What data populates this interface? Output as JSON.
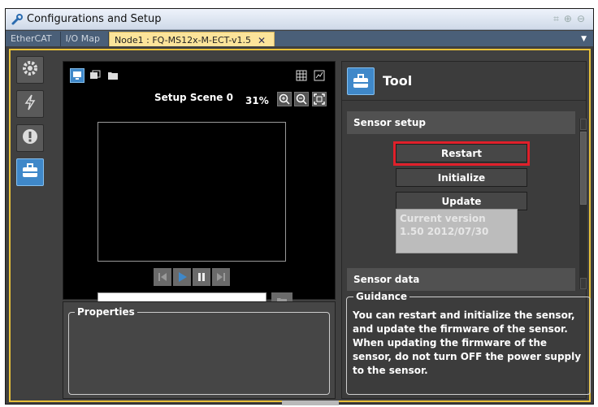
{
  "window": {
    "title": "Configurations and Setup"
  },
  "tabs": [
    {
      "label": "EtherCAT"
    },
    {
      "label": "I/O Map"
    },
    {
      "label": "Node1 : FQ-MS12x-M-ECT-v1.5",
      "active": true
    }
  ],
  "sidebar": {
    "items": [
      {
        "icon": "gear-icon"
      },
      {
        "icon": "lightning-icon"
      },
      {
        "icon": "exclamation-icon"
      },
      {
        "icon": "toolbox-icon",
        "active": true
      }
    ]
  },
  "viewer": {
    "scene_label": "Setup Scene 0",
    "zoom": "31%",
    "scene_input_value": ""
  },
  "properties": {
    "legend": "Properties"
  },
  "tool": {
    "title": "Tool",
    "sensor_setup": {
      "heading": "Sensor setup",
      "restart_label": "Restart",
      "initialize_label": "Initialize",
      "update_label": "Update",
      "version_label": "Current version",
      "version_value": "1.50 2012/07/30"
    },
    "sensor_data_heading": "Sensor data",
    "guidance": {
      "legend": "Guidance",
      "text": "You can restart and initialize the sensor, and update the firmware of the sensor. When updating the firmware of the sensor, do not turn OFF the power supply to the sensor."
    }
  },
  "colors": {
    "accent": "#3f88c9",
    "highlight": "#e0202a",
    "focus_border": "#e8c13a"
  }
}
